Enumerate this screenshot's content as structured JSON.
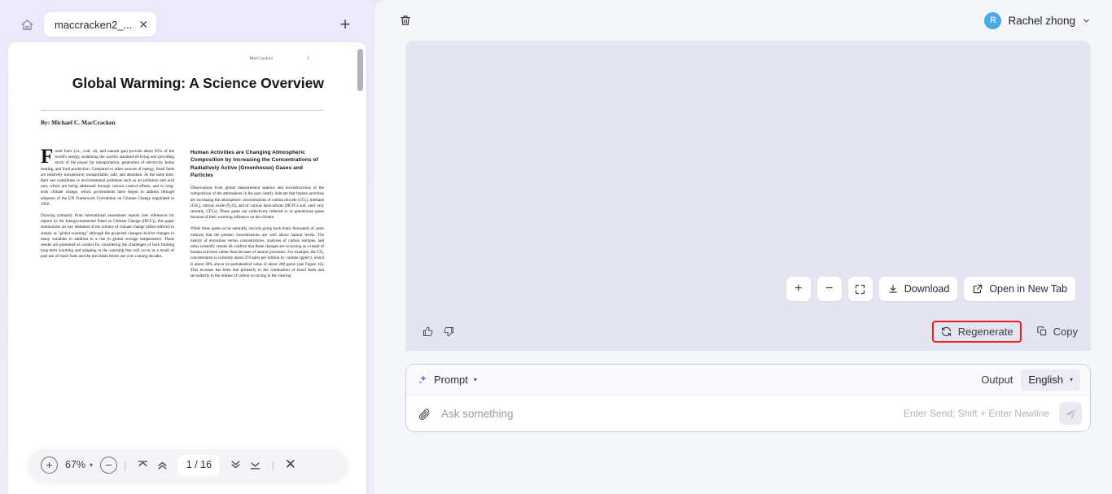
{
  "viewer": {
    "home_icon": "home-icon",
    "tab": {
      "label": "maccracken2_...",
      "close": "✕"
    },
    "new_tab": "+",
    "toolbar": {
      "zoom_in": "+",
      "zoom_level": "67%",
      "zoom_caret": "▾",
      "zoom_out": "−",
      "divider": "|",
      "first_page_icon": "jump-to-first-page-icon",
      "prev_page_icon": "previous-page-icon",
      "page_indicator": "1 / 16",
      "next_page_icon": "next-page-icon",
      "last_page_icon": "jump-to-last-page-icon",
      "close": "✕"
    }
  },
  "document": {
    "running_head": "MacCracken",
    "page_number": "1",
    "title": "Global Warming: A Science Overview",
    "author": "By: Michael C. MacCracken",
    "left_column": [
      "Fossil fuels (i.e., coal, oil, and natural gas) provide about 85% of the world's energy, sustaining the world's standard-of-living and providing much of the power for transportation, generation of electricity, home heating, and food production. Compared to other sources of energy, fossil fuels are relatively inexpensive, transportable, safe, and abundant. At the same time, their use contributes to environmental problems such as air pollution and acid rain, which are being addressed through various control efforts, and to long-term climate change, which governments have begun to address through adoption of the UN Framework Convention on Climate Change negotiated in 1992.",
      "Drawing primarily from international assessment reports (see references for reports by the Intergovernmental Panel on Climate Change (IPCC)), this paper summarizes six key elements of the science of climate change (often referred to simply as \"global warming\" although the projected changes involve changes in many variables in addition to a rise in global average temperature). These results are presented as context for considering the challenges of both limiting long-term warming and adapting to the warming that will occur as a result of past use of fossil fuels and the inevitable future use over coming decades."
    ],
    "right_heading": "Human Activities are Changing Atmospheric Composition by Increasing the Concentrations of Radiatively Active (Greenhouse) Gases and Particles",
    "right_column": [
      "Observations from global measurement stations and reconstructions of the composition of the atmosphere in the past clearly indicate that human activities are increasing the atmospheric concentrations of carbon dioxide (CO₂), methane (CH₄), nitrous oxide (N₂O), and of various halocarbons (HCFCs and, until very recently, CFCs). These gases are collectively referred to as greenhouse gases because of their warming influence on the climate.",
      "While these gases occur naturally, records going back many thousands of years indicate that the present concentrations are well above natural levels. The history of emissions versus concentrations, analyses of carbon isotopes, and other scientific results all confirm that these changes are occurring as a result of human activities rather than because of natural processes. For example, the CO₂ concentration is currently about 370 parts per million by volume (ppmv), which is about 30% above its preindustrial value of about 280 ppmv (see Figure 1b). This increase has been due primarily to the combustion of fossil fuels and secondarily to the release of carbon occurring in the clearing"
    ]
  },
  "chat": {
    "header": {
      "trash_icon": "trash-icon",
      "user_initial": "R",
      "user_name": "Rachel zhong",
      "chevron": "⌄"
    },
    "answer_tools": {
      "zoom_in": "+",
      "zoom_out": "−",
      "fullscreen_icon": "expand-icon",
      "download_label": "Download",
      "open_new_tab_label": "Open in New Tab"
    },
    "feedback": {
      "thumbs_up_icon": "thumbs-up-icon",
      "thumbs_down_icon": "thumbs-down-icon"
    },
    "actions": {
      "regenerate_label": "Regenerate",
      "copy_label": "Copy",
      "highlight_color": "#f31a1a"
    }
  },
  "composer": {
    "sparkle_icon": "sparkle-icon",
    "prompt_label": "Prompt",
    "prompt_caret": "▾",
    "output_label": "Output",
    "language_value": "English",
    "language_caret": "▾",
    "attach_icon": "paperclip-icon",
    "input_value": "",
    "input_placeholder": "Ask something",
    "hint": "Enter Send; Shift + Enter Newline",
    "send_icon": "send-icon"
  }
}
